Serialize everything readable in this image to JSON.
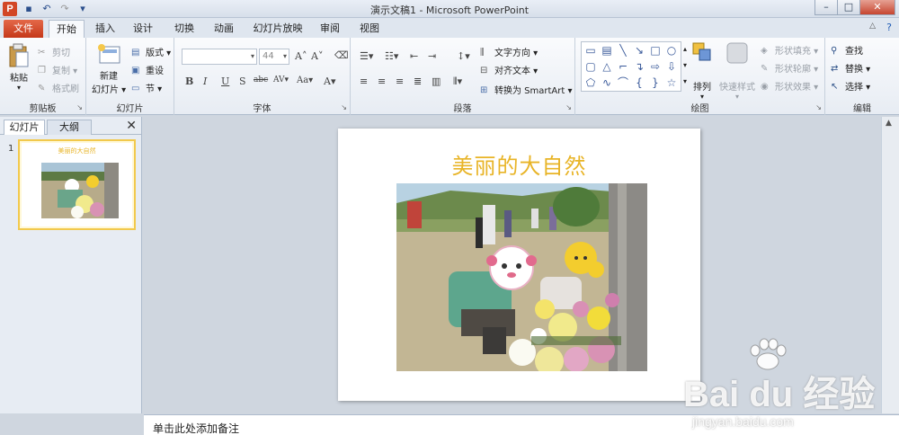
{
  "window": {
    "title": "演示文稿1 - Microsoft PowerPoint",
    "app_icon": "P",
    "quick_access": [
      "save-icon",
      "undo-icon",
      "redo-icon",
      "customize-icon"
    ]
  },
  "tabs": [
    "文件",
    "开始",
    "插入",
    "设计",
    "切换",
    "动画",
    "幻灯片放映",
    "审阅",
    "视图"
  ],
  "active_tab": "开始",
  "ribbon": {
    "clipboard": {
      "label": "剪贴板",
      "paste": "粘贴",
      "cut": "剪切",
      "copy": "复制",
      "format_painter": "格式刷"
    },
    "slides": {
      "label": "幻灯片",
      "new_slide_1": "新建",
      "new_slide_2": "幻灯片",
      "layout": "版式",
      "reset": "重设",
      "section": "节"
    },
    "font": {
      "label": "字体",
      "font_name": "",
      "font_size": "44"
    },
    "paragraph": {
      "label": "段落",
      "text_direction": "文字方向",
      "align_text": "对齐文本",
      "smartart": "转换为 SmartArt"
    },
    "drawing": {
      "label": "绘图",
      "arrange": "排列",
      "quick_styles": "快速样式",
      "shape_fill": "形状填充",
      "shape_outline": "形状轮廓",
      "shape_effects": "形状效果"
    },
    "editing": {
      "label": "编辑",
      "find": "查找",
      "replace": "替换",
      "select": "选择"
    }
  },
  "left_pane": {
    "tab_slides": "幻灯片",
    "tab_outline": "大纲",
    "slide_number": "1",
    "thumb_title": "美丽的大自然"
  },
  "slide": {
    "title": "美丽的大自然"
  },
  "notes": {
    "placeholder": "单击此处添加备注"
  },
  "watermark": {
    "brand": "Bai du 经验",
    "site": "jingyan.baidu.com"
  },
  "colors": {
    "file_tab": "#c5381a",
    "slide_title": "#e8b427",
    "thumb_border": "#f2c94c"
  }
}
